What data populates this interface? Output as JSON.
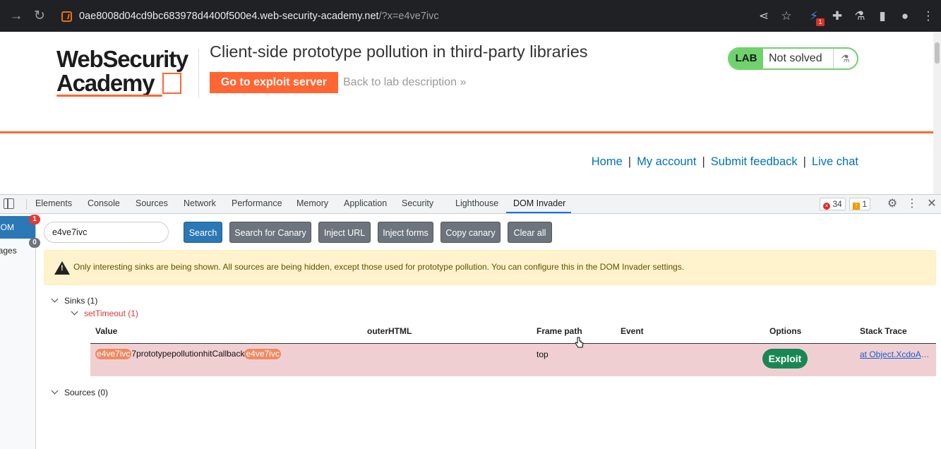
{
  "browser": {
    "url_host": "0ae8008d04cd9bc683978d4400f500e4.web-security-academy.net",
    "url_path": "/?x=e4ve7ivc",
    "extension_badge": "1"
  },
  "page": {
    "logo_line1": "WebSecurity",
    "logo_line2": "Academy",
    "lab_title": "Client-side prototype pollution in third-party libraries",
    "exploit_server_button": "Go to exploit server",
    "back_link": "Back to lab description",
    "lab_tag": "LAB",
    "lab_status": "Not solved",
    "nav": {
      "home": "Home",
      "account": "My account",
      "feedback": "Submit feedback",
      "chat": "Live chat",
      "separator": "|"
    }
  },
  "devtools": {
    "tabs": [
      "Elements",
      "Console",
      "Sources",
      "Network",
      "Performance",
      "Memory",
      "Application",
      "Security",
      "Lighthouse",
      "DOM Invader"
    ],
    "error_count": "34",
    "warning_count": "1"
  },
  "dom_invader": {
    "sidebar": [
      {
        "label": "DOM",
        "badge": "1"
      },
      {
        "label": "Messages",
        "badge": "0"
      }
    ],
    "canary_value": "e4ve7ivc",
    "buttons": {
      "search": "Search",
      "search_canary": "Search for Canary",
      "inject_url": "Inject URL",
      "inject_forms": "Inject forms",
      "copy_canary": "Copy canary",
      "clear_all": "Clear all"
    },
    "warning": "Only interesting sinks are being shown. All sources are being hidden, except those used for prototype pollution. You can configure this in the DOM Invader settings.",
    "sinks_label": "Sinks (1)",
    "sink_name": "setTimeout (1)",
    "sources_label": "Sources (0)",
    "columns": {
      "value": "Value",
      "outer_html": "outerHTML",
      "frame_path": "Frame path",
      "event": "Event",
      "options": "Options",
      "stack_trace": "Stack Trace"
    },
    "row": {
      "canary_prefix": "e4ve7ivc",
      "value_middle": "7prototypepollutionhitCallback",
      "canary_suffix": "e4ve7ivc",
      "frame_path": "top",
      "exploit_label": "Exploit",
      "stack_trace": "at Object.XcdoAwaitTimeout"
    }
  }
}
